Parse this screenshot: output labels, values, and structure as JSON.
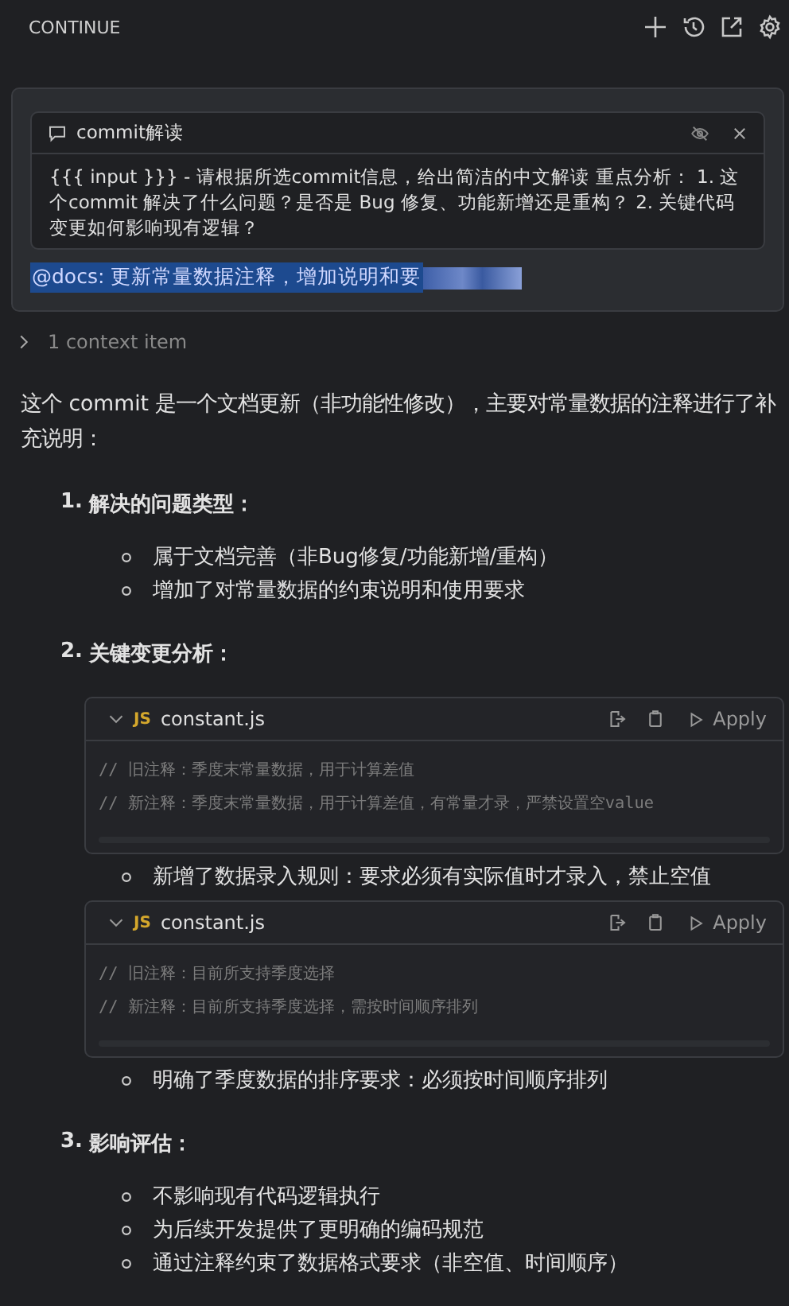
{
  "header": {
    "title": "CONTINUE"
  },
  "prompt": {
    "command": {
      "title": "commit解读",
      "text": "{{{ input }}} - 请根据所选commit信息，给出简洁的中文解读 重点分析： 1. 这个commit 解决了什么问题？是否是 Bug 修复、功能新增还是重构？ 2. 关键代码变更如何影响现有逻辑？"
    },
    "input": {
      "value": "@docs: 更新常量数据注释，增加说明和要",
      "selected": true,
      "redacted": true
    }
  },
  "context": {
    "label": "1 context item",
    "expanded": false
  },
  "response": {
    "intro": "这个 commit 是一个文档更新（非功能性修改），主要对常量数据的注释进行了补充说明：",
    "sections": [
      {
        "number": "1.",
        "heading": "解决的问题类型：",
        "items": [
          {
            "kind": "bullet",
            "text": "属于文档完善（非Bug修复/功能新增/重构）"
          },
          {
            "kind": "bullet",
            "text": "增加了对常量数据的约束说明和使用要求"
          }
        ]
      },
      {
        "number": "2.",
        "heading": "关键变更分析：",
        "items": [
          {
            "kind": "code",
            "language": "JS",
            "filename": "constant.js",
            "apply": "Apply",
            "lines": [
              "// 旧注释：季度末常量数据，用于计算差值",
              "// 新注释：季度末常量数据，用于计算差值，有常量才录，严禁设置空value"
            ]
          },
          {
            "kind": "bullet",
            "text": "新增了数据录入规则：要求必须有实际值时才录入，禁止空值"
          },
          {
            "kind": "code",
            "language": "JS",
            "filename": "constant.js",
            "apply": "Apply",
            "lines": [
              "// 旧注释：目前所支持季度选择",
              "// 新注释：目前所支持季度选择，需按时间顺序排列"
            ]
          },
          {
            "kind": "bullet",
            "text": "明确了季度数据的排序要求：必须按时间顺序排列"
          }
        ]
      },
      {
        "number": "3.",
        "heading": "影响评估：",
        "items": [
          {
            "kind": "bullet",
            "text": "不影响现有代码逻辑执行"
          },
          {
            "kind": "bullet",
            "text": "为后续开发提供了更明确的编码规范"
          },
          {
            "kind": "bullet",
            "text": "通过注释约束了数据格式要求（非空值、时间顺序）"
          }
        ]
      }
    ]
  }
}
